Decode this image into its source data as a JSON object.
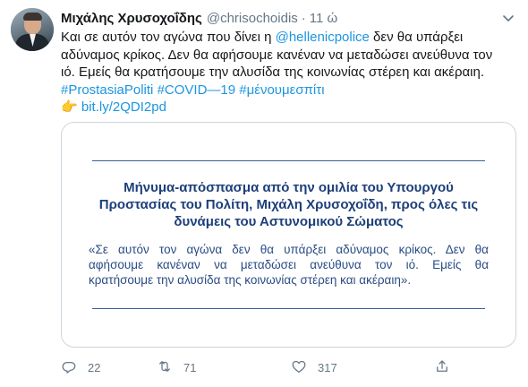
{
  "author": {
    "name": "Μιχάλης Χρυσοχοΐδης",
    "handle": "@chrisochoidis",
    "separator": "·",
    "time": "11 ώ"
  },
  "tweet": {
    "line1_pre": "Και σε αυτόν τον αγώνα που δίνει η ",
    "line1_mention": "@hellenicpolice",
    "line1_post": " δεν θα υπάρξει",
    "line2": "αδύναμος κρίκος. Δεν θα αφήσουμε κανέναν να μεταδώσει ανεύθυνα τον",
    "line3": "ιό. Εμείς θα κρατήσουμε την αλυσίδα της κοινωνίας στέρεη και ακέραιη.",
    "hashtags": [
      "#ProstasiaPoliti",
      "#COVID—19",
      "#μένουμεσπίτι"
    ],
    "pointer_emoji": "👉",
    "url": "bit.ly/2QDI2pd"
  },
  "card": {
    "title_lines": [
      "Μήνυμα-απόσπασμα από την ομιλία του Υπουργού",
      "Προστασίας του Πολίτη, Μιχάλη Χρυσοχοΐδη, προς όλες τις",
      "δυνάμεις του Αστυνομικού Σώματος"
    ],
    "quote_lines": [
      "«Σε αυτόν τον αγώνα δεν θα υπάρξει αδύναμος κρίκος. Δεν θα",
      "αφήσουμε κανέναν να μεταδώσει ανεύθυνα τον ιό. Εμείς θα",
      "κρατήσουμε την αλυσίδα της κοινωνίας στέρεη και ακέραιη»."
    ],
    "colors": {
      "title": "#1d3f7a",
      "quote": "#2a4c84",
      "rule": "#3a5f9a"
    }
  },
  "actions": {
    "reply_count": "22",
    "retweet_count": "71",
    "like_count": "317"
  },
  "icons": [
    "chevron-down-icon",
    "reply-icon",
    "retweet-icon",
    "heart-icon",
    "share-icon"
  ],
  "colors": {
    "link": "#1b95e0",
    "muted": "#657786",
    "text": "#14171a",
    "border": "#ccd6dd"
  }
}
